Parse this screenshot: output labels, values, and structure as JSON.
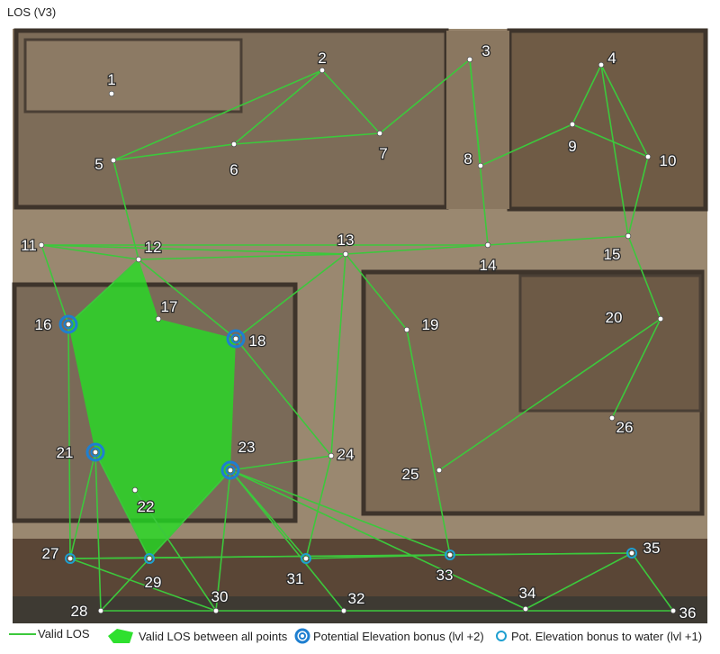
{
  "title": "LOS (V3)",
  "colors": {
    "los_line": "#3cc83c",
    "los_area": "#22e022",
    "elevation_ring": "#1e7fd0",
    "ground": "#9a8870",
    "wall": "#4a3f35",
    "floor": "#7a6a58"
  },
  "points": [
    {
      "id": "1",
      "label": "1",
      "elevation": "none"
    },
    {
      "id": "2",
      "label": "2",
      "elevation": "none"
    },
    {
      "id": "3",
      "label": "3",
      "elevation": "none"
    },
    {
      "id": "4",
      "label": "4",
      "elevation": "none"
    },
    {
      "id": "5",
      "label": "5",
      "elevation": "none"
    },
    {
      "id": "6",
      "label": "6",
      "elevation": "none"
    },
    {
      "id": "7",
      "label": "7",
      "elevation": "none"
    },
    {
      "id": "8",
      "label": "8",
      "elevation": "none"
    },
    {
      "id": "9",
      "label": "9",
      "elevation": "none"
    },
    {
      "id": "10",
      "label": "10",
      "elevation": "none"
    },
    {
      "id": "11",
      "label": "11",
      "elevation": "none"
    },
    {
      "id": "12",
      "label": "12",
      "elevation": "none"
    },
    {
      "id": "13",
      "label": "13",
      "elevation": "none"
    },
    {
      "id": "14",
      "label": "14",
      "elevation": "none"
    },
    {
      "id": "15",
      "label": "15",
      "elevation": "none"
    },
    {
      "id": "16",
      "label": "16",
      "elevation": "lvl+2"
    },
    {
      "id": "17",
      "label": "17",
      "elevation": "none"
    },
    {
      "id": "18",
      "label": "18",
      "elevation": "lvl+2"
    },
    {
      "id": "19",
      "label": "19",
      "elevation": "none"
    },
    {
      "id": "20",
      "label": "20",
      "elevation": "none"
    },
    {
      "id": "21",
      "label": "21",
      "elevation": "lvl+2"
    },
    {
      "id": "22",
      "label": "22",
      "elevation": "none"
    },
    {
      "id": "23",
      "label": "23",
      "elevation": "lvl+2"
    },
    {
      "id": "24",
      "label": "24",
      "elevation": "none"
    },
    {
      "id": "25",
      "label": "25",
      "elevation": "none"
    },
    {
      "id": "26",
      "label": "26",
      "elevation": "none"
    },
    {
      "id": "27",
      "label": "27",
      "elevation": "water"
    },
    {
      "id": "28",
      "label": "28",
      "elevation": "none"
    },
    {
      "id": "29",
      "label": "29",
      "elevation": "water"
    },
    {
      "id": "30",
      "label": "30",
      "elevation": "none"
    },
    {
      "id": "31",
      "label": "31",
      "elevation": "water"
    },
    {
      "id": "32",
      "label": "32",
      "elevation": "none"
    },
    {
      "id": "33",
      "label": "33",
      "elevation": "water"
    },
    {
      "id": "34",
      "label": "34",
      "elevation": "none"
    },
    {
      "id": "35",
      "label": "35",
      "elevation": "water"
    },
    {
      "id": "36",
      "label": "36",
      "elevation": "none"
    }
  ],
  "los_lines": [
    [
      "5",
      "6"
    ],
    [
      "5",
      "2"
    ],
    [
      "2",
      "7"
    ],
    [
      "6",
      "2"
    ],
    [
      "6",
      "7"
    ],
    [
      "7",
      "3"
    ],
    [
      "3",
      "14"
    ],
    [
      "3",
      "8"
    ],
    [
      "8",
      "9"
    ],
    [
      "9",
      "4"
    ],
    [
      "4",
      "10"
    ],
    [
      "4",
      "15"
    ],
    [
      "9",
      "10"
    ],
    [
      "10",
      "15"
    ],
    [
      "11",
      "12"
    ],
    [
      "11",
      "13"
    ],
    [
      "11",
      "14"
    ],
    [
      "12",
      "13"
    ],
    [
      "13",
      "14"
    ],
    [
      "14",
      "15"
    ],
    [
      "11",
      "16"
    ],
    [
      "12",
      "16"
    ],
    [
      "12",
      "18"
    ],
    [
      "13",
      "18"
    ],
    [
      "13",
      "24"
    ],
    [
      "15",
      "20"
    ],
    [
      "20",
      "25"
    ],
    [
      "20",
      "26"
    ],
    [
      "19",
      "33"
    ],
    [
      "19",
      "13"
    ],
    [
      "24",
      "31"
    ],
    [
      "23",
      "24"
    ],
    [
      "21",
      "27"
    ],
    [
      "21",
      "28"
    ],
    [
      "23",
      "29"
    ],
    [
      "23",
      "30"
    ],
    [
      "23",
      "31"
    ],
    [
      "23",
      "32"
    ],
    [
      "23",
      "33"
    ],
    [
      "23",
      "34"
    ],
    [
      "27",
      "33"
    ],
    [
      "27",
      "35"
    ],
    [
      "28",
      "36"
    ],
    [
      "33",
      "35"
    ],
    [
      "35",
      "36"
    ],
    [
      "34",
      "35"
    ],
    [
      "31",
      "33"
    ],
    [
      "29",
      "23"
    ],
    [
      "16",
      "27"
    ],
    [
      "21",
      "29"
    ],
    [
      "18",
      "24"
    ],
    [
      "12",
      "5"
    ],
    [
      "22",
      "30"
    ],
    [
      "27",
      "30"
    ],
    [
      "29",
      "28"
    ]
  ],
  "legend": {
    "valid_los": "Valid LOS",
    "valid_los_all": "Valid LOS between all points",
    "elevation_bonus": "Potential Elevation bonus (lvl +2)",
    "water_bonus": "Pot. Elevation bonus to water (lvl +1)"
  }
}
